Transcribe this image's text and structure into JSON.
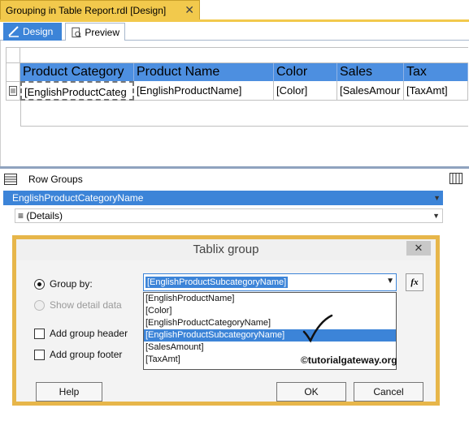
{
  "document_tab": {
    "title": "Grouping in Table Report.rdl [Design]",
    "close": "✕"
  },
  "view_tabs": {
    "design": "Design",
    "preview": "Preview"
  },
  "table": {
    "headers": [
      "Product Category",
      "Product Name",
      "Color",
      "Sales",
      "Tax"
    ],
    "details": [
      "[EnglishProductCateg",
      "[EnglishProductName]",
      "[Color]",
      "[SalesAmour",
      "[TaxAmt]"
    ]
  },
  "groups_pane": {
    "title": "Row Groups",
    "groups": [
      "EnglishProductCategoryName",
      "≡ (Details)"
    ]
  },
  "dialog": {
    "title": "Tablix group",
    "close": "✕",
    "group_by_label": "Group by:",
    "group_by_value": "[EnglishProductSubcategoryName]",
    "show_detail_label": "Show detail data",
    "add_header_label": "Add group header",
    "add_footer_label": "Add group footer",
    "fx_label": "fx",
    "options": [
      "[EnglishProductName]",
      "[Color]",
      "[EnglishProductCategoryName]",
      "[EnglishProductSubcategoryName]",
      "[SalesAmount]",
      "[TaxAmt]"
    ],
    "selected_option_index": 3,
    "watermark": "©tutorialgateway.org",
    "help": "Help",
    "ok": "OK",
    "cancel": "Cancel"
  },
  "colors": {
    "accent": "#3c84d8",
    "header_fill": "#4d8fe0",
    "tab_gold": "#f2c94c",
    "dialog_border": "#e7b64a"
  }
}
